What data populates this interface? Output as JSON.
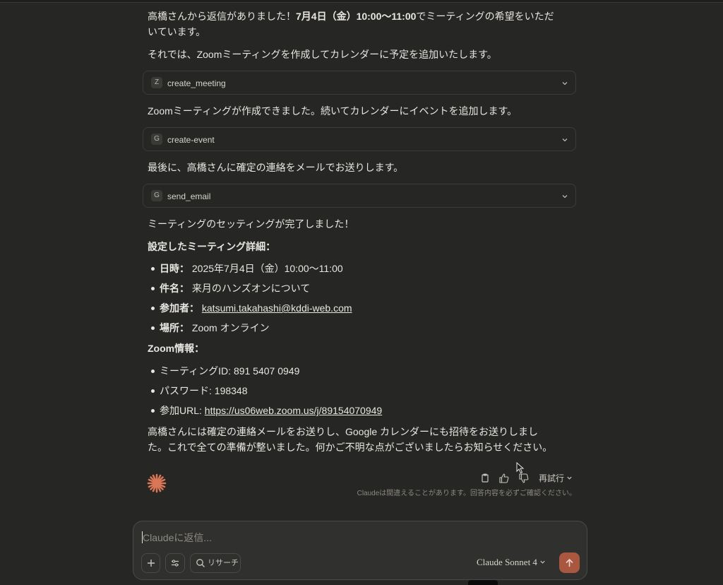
{
  "messages": {
    "p1_pre": "高橋さんから返信がありました！",
    "p1_bold": "7月4日（金）10:00〜11:00",
    "p1_post": "でミーティングの希望をいただいています。",
    "p2": "それでは、Zoomミーティングを作成してカレンダーに予定を追加いたします。",
    "p3": "Zoomミーティングが作成できました。続いてカレンダーにイベントを追加します。",
    "p4": "最後に、高橋さんに確定の連絡をメールでお送りします。",
    "p5": "ミーティングのセッティングが完了しました！",
    "details_heading": "設定したミーティング詳細：",
    "zoom_heading": "Zoom情報：",
    "closing": "高橋さんには確定の連絡メールをお送りし、Google カレンダーにも招待をお送りしました。これで全ての準備が整いました。何かご不明な点がございましたらお知らせください。"
  },
  "tools": [
    {
      "badge": "Z",
      "name": "create_meeting"
    },
    {
      "badge": "G",
      "name": "create-event"
    },
    {
      "badge": "G",
      "name": "send_email"
    }
  ],
  "details": [
    {
      "label": "日時：",
      "value": "2025年7月4日（金）10:00〜11:00"
    },
    {
      "label": "件名：",
      "value": "来月のハンズオンについて"
    },
    {
      "label": "参加者：",
      "value": "katsumi.takahashi@kddi-web.com"
    },
    {
      "label": "場所：",
      "value": "Zoom オンライン"
    }
  ],
  "zoom": {
    "meeting_id": "ミーティングID: 891 5407 0949",
    "password": "パスワード: 198348",
    "url_label": "参加URL: ",
    "url": "https://us06web.zoom.us/j/89154070949"
  },
  "actions": {
    "retry": "再試行",
    "disclaimer": "Claudeは間違えることがあります。回答内容を必ずご確認ください。"
  },
  "composer": {
    "placeholder": "Claudeに返信...",
    "research": "リサーチ",
    "model": "Claude Sonnet 4"
  },
  "colors": {
    "background": "#262624",
    "accent": "#d97757",
    "send": "#a9573f"
  }
}
